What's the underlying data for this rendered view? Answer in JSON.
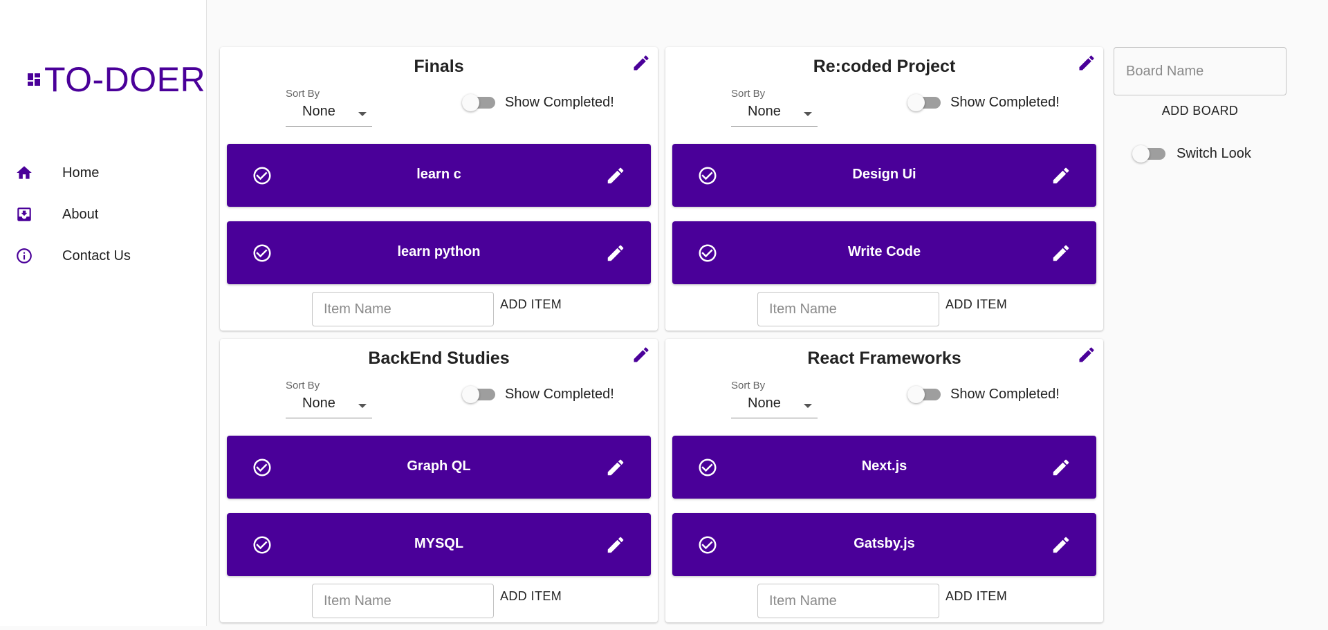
{
  "app": {
    "title": "TO-DOER",
    "brand_color": "#4a0099"
  },
  "sidebar": {
    "items": [
      {
        "label": "Home",
        "icon": "home-icon"
      },
      {
        "label": "About",
        "icon": "move-to-inbox-icon"
      },
      {
        "label": "Contact Us",
        "icon": "info-icon"
      }
    ]
  },
  "boards": [
    {
      "title": "Finals",
      "sort_label": "Sort By",
      "sort_value": "None",
      "toggle_label": "Show Completed!",
      "show_completed": false,
      "items": [
        "learn c",
        "learn python"
      ],
      "item_placeholder": "Item Name",
      "add_item_label": "ADD ITEM"
    },
    {
      "title": "Re:coded Project",
      "sort_label": "Sort By",
      "sort_value": "None",
      "toggle_label": "Show Completed!",
      "show_completed": false,
      "items": [
        "Design Ui",
        "Write Code"
      ],
      "item_placeholder": "Item Name",
      "add_item_label": "ADD ITEM"
    },
    {
      "title": "BackEnd Studies",
      "sort_label": "Sort By",
      "sort_value": "None",
      "toggle_label": "Show Completed!",
      "show_completed": false,
      "items": [
        "Graph QL",
        "MYSQL"
      ],
      "item_placeholder": "Item Name",
      "add_item_label": "ADD ITEM"
    },
    {
      "title": "React Frameworks",
      "sort_label": "Sort By",
      "sort_value": "None",
      "toggle_label": "Show Completed!",
      "show_completed": false,
      "items": [
        "Next.js",
        "Gatsby.js"
      ],
      "item_placeholder": "Item Name",
      "add_item_label": "ADD ITEM"
    }
  ],
  "right_panel": {
    "board_name_placeholder": "Board Name",
    "add_board_label": "ADD BOARD",
    "switch_look_label": "Switch Look",
    "switch_look_on": false
  }
}
